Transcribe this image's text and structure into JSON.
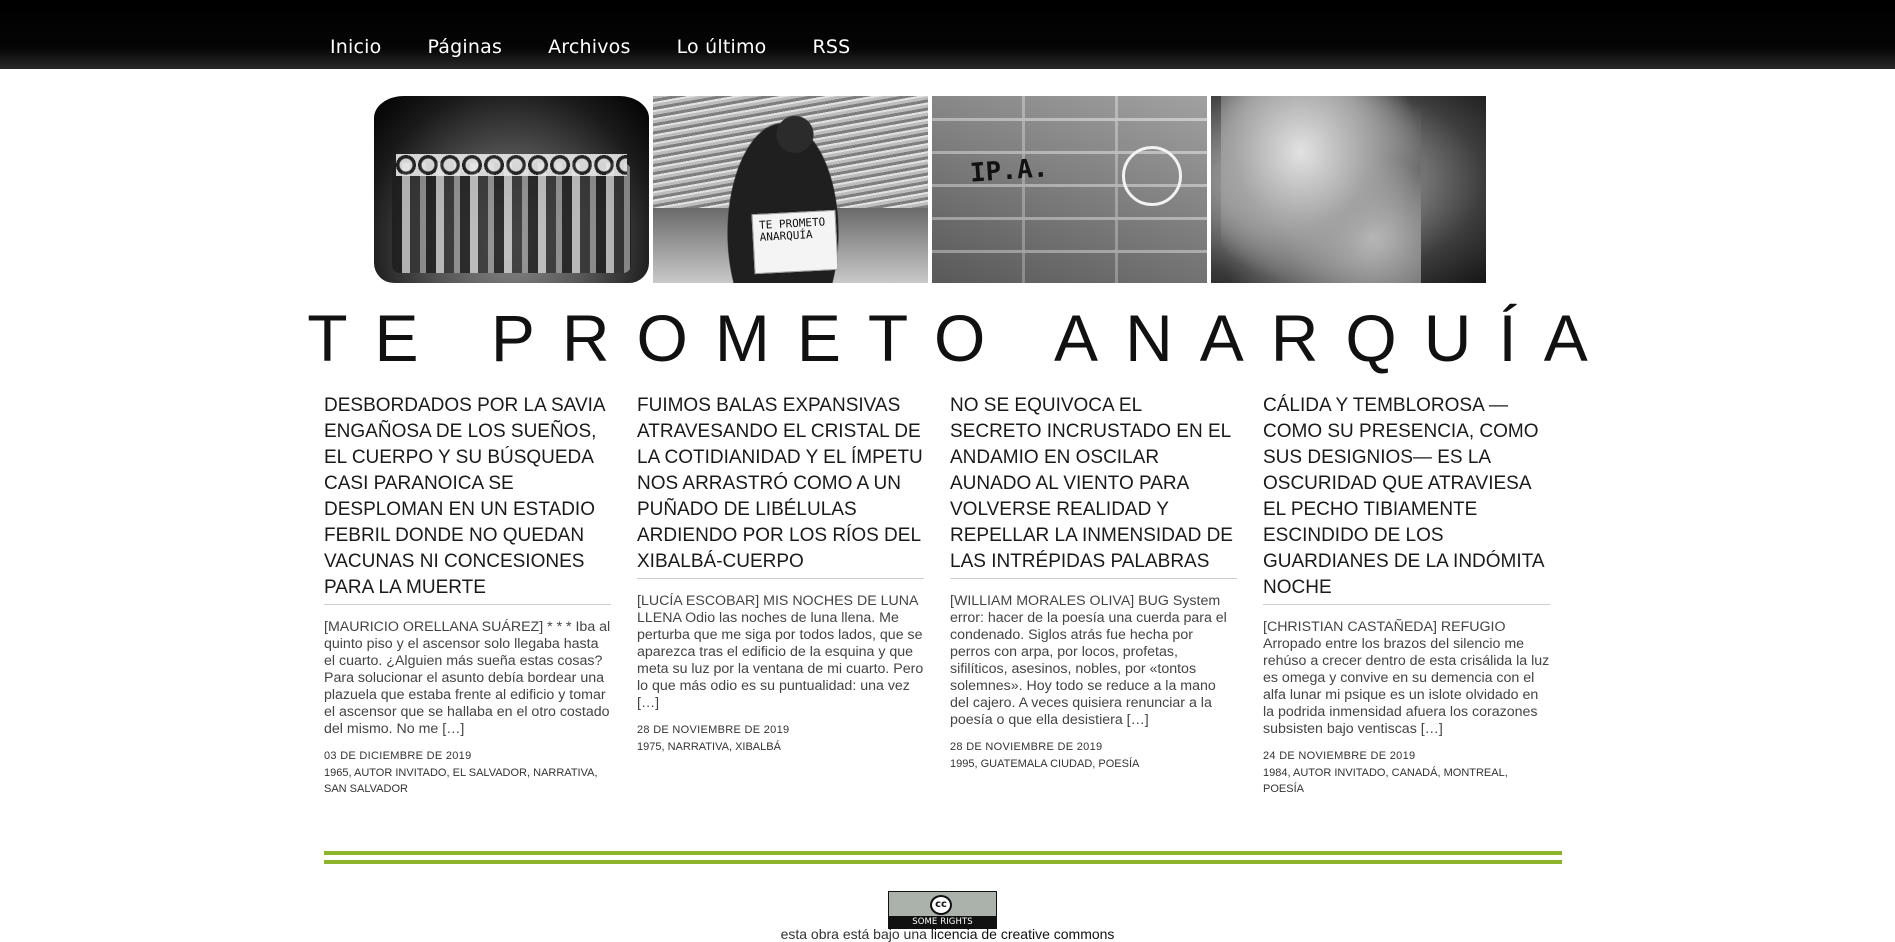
{
  "nav": {
    "items": [
      "Inicio",
      "Páginas",
      "Archivos",
      "Lo último",
      "RSS"
    ]
  },
  "banner": {
    "sign_text": "TE PROMETO ANARQUÍA",
    "graffiti_text": "IP.A."
  },
  "site": {
    "title": "TE PROMETO ANARQUÍA"
  },
  "posts": [
    {
      "title": "Desbordados por la savia engañosa de los sueños, el cuerpo y su búsqueda casi paranoica se desploman en un estadio febril donde no quedan vacunas ni concesiones para la muerte",
      "excerpt": "[MAURICIO ORELLANA SUÁREZ]      * * *    Iba al quinto piso y el ascensor solo llegaba hasta el cuarto. ¿Alguien más sueña estas cosas? Para solucionar el asunto debía bordear una plazuela que estaba frente al edificio y tomar el ascensor que se hallaba en el otro costado del mismo. No me ",
      "more": "[…]",
      "date": "03 DE DICIEMBRE DE 2019",
      "tags": [
        "1965",
        "AUTOR INVITADO",
        "EL SALVADOR",
        "NARRATIVA",
        "SAN SALVADOR"
      ]
    },
    {
      "title": "Fuimos balas expansivas atravesando el cristal de la cotidianidad y el ímpetu nos arrastró como a un puñado de libélulas ardiendo por los ríos del Xibalbá-cuerpo",
      "excerpt": "[LUCÍA ESCOBAR]     MIS NOCHES DE LUNA LLENA   Odio las noches de luna llena. Me perturba que me siga por todos lados, que se aparezca tras el edificio de la esquina y que meta su luz por la ventana de mi cuarto. Pero lo que más odio es su puntualidad: una vez ",
      "more": "[…]",
      "date": "28 DE NOVIEMBRE DE 2019",
      "tags": [
        "1975",
        "NARRATIVA",
        "XIBALBÁ"
      ]
    },
    {
      "title": "No se equivoca el secreto incrustado en el andamio en oscilar aunado al viento para volverse realidad y repellar la inmensidad de las intrépidas palabras",
      "excerpt": "[WILLIAM MORALES OLIVA]   BUG System error: hacer de la poesía una cuerda para el condenado. Siglos atrás fue hecha por perros con arpa, por locos, profetas, sifilíticos, asesinos, nobles, por «tontos solemnes». Hoy todo se reduce a la mano del cajero. A veces quisiera renunciar a la poesía o que ella desistiera ",
      "more": "[…]",
      "date": "28 DE NOVIEMBRE DE 2019",
      "tags": [
        "1995",
        "GUATEMALA CIUDAD",
        "POESÍA"
      ]
    },
    {
      "title": "Cálida y temblorosa —como su presencia, como sus designios— es la oscuridad que atraviesa el pecho tibiamente escindido de los guardianes de la indómita noche",
      "excerpt": "[CHRISTIAN CASTAÑEDA]      REFUGIO    Arropado entre los brazos del silencio me rehúso a crecer   dentro de esta crisálida la luz es omega y convive en su demencia con el alfa lunar   mi psique es un islote olvidado en la podrida inmensidad   afuera los corazones subsisten bajo ventiscas ",
      "more": "[…]",
      "date": "24 DE NOVIEMBRE DE 2019",
      "tags": [
        "1984",
        "AUTOR INVITADO",
        "CANADÁ",
        "MONTREAL",
        "POESÍA"
      ]
    }
  ],
  "footer": {
    "badge_symbol": "cc",
    "badge_text": "SOME RIGHTS RESERVED",
    "license_prefix": "esta obra está bajo una ",
    "license_link": "licencia de creative commons",
    "accent_color": "#8db42a"
  }
}
